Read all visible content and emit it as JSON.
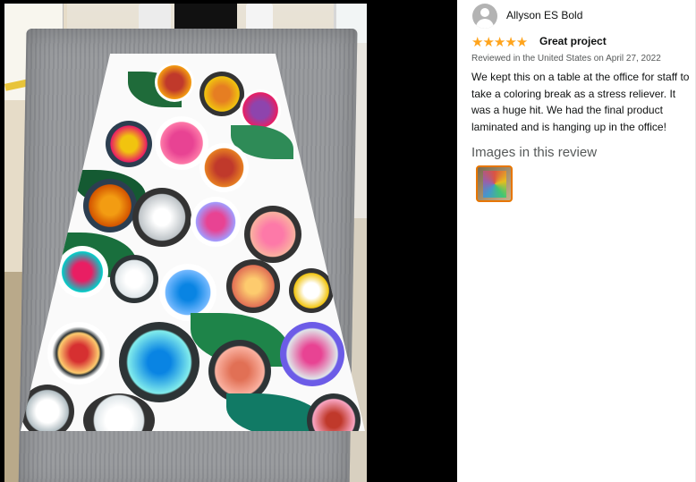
{
  "review": {
    "reviewer_name": "Allyson ES Bold",
    "rating": 5,
    "stars_text": "★★★★★",
    "title": "Great project",
    "date_text": "Reviewed in the United States on April 27, 2022",
    "body": "We kept this on a table at the office for staff to take a coloring break as a stress reliever. It was a huge hit. We had the final product laminated and is hanging up in the office!",
    "images_heading": "Images in this review"
  },
  "colors": {
    "star": "#ffa41c",
    "thumbnail_border": "#e77600",
    "date_text": "#565959"
  },
  "icons": {
    "avatar": "user-avatar-icon",
    "star": "star-icon"
  }
}
